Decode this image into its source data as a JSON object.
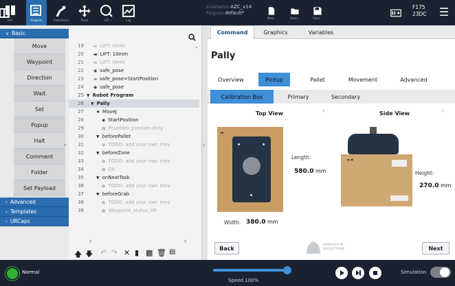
{
  "header": {
    "buttons": [
      {
        "label": "Run"
      },
      {
        "label": "Program"
      },
      {
        "label": "Installation"
      },
      {
        "label": "Move"
      },
      {
        "label": "I/O"
      },
      {
        "label": "Log"
      }
    ],
    "installation_label": "Installation",
    "installation_value": "AZC_v14",
    "program_label": "Program",
    "program_value": "default*",
    "new_label": "New...",
    "open_label": "Open...",
    "save_label": "Save...",
    "robot_name": "F175",
    "robot_sub": "23DC"
  },
  "nav": {
    "basic_label": "Basic",
    "items": [
      "Move",
      "Waypoint",
      "Direction",
      "Wait",
      "Set",
      "Popup",
      "Halt",
      "Comment",
      "Folder",
      "Set Payload"
    ],
    "advanced_label": "Advanced",
    "templates_label": "Templates",
    "urcaps_label": "URCaps"
  },
  "tree": {
    "rows": [
      {
        "n": "19",
        "t": "LIFT: 0mm"
      },
      {
        "n": "20",
        "t": "LIFT: 10mm"
      },
      {
        "n": "21",
        "t": "LIFT: 0mm"
      },
      {
        "n": "22",
        "t": "safe_pose"
      },
      {
        "n": "23",
        "t": "safe_pose=StartPosition"
      },
      {
        "n": "24",
        "t": "safe_pose"
      },
      {
        "n": "25",
        "t": "Robot Program"
      },
      {
        "n": "26",
        "t": "Pally"
      },
      {
        "n": "27",
        "t": "MoveJ"
      },
      {
        "n": "28",
        "t": "StartPosition"
      },
      {
        "n": "29",
        "t": "Pcustom_position.dirty"
      },
      {
        "n": "30",
        "t": "beforePallet"
      },
      {
        "n": "31",
        "t": "TODO: add your own mov"
      },
      {
        "n": "32",
        "t": "beforeZone"
      },
      {
        "n": "33",
        "t": "TODO: add your own mov"
      },
      {
        "n": "34",
        "t": "Ok"
      },
      {
        "n": "35",
        "t": "onNextTask"
      },
      {
        "n": "36",
        "t": "TODO: add your own mov"
      },
      {
        "n": "37",
        "t": "beforeGrab"
      },
      {
        "n": "38",
        "t": "TODO: add your own mov"
      },
      {
        "n": "39",
        "t": "Waypoint_status_lift"
      }
    ]
  },
  "right": {
    "top_tabs": [
      "Command",
      "Graphics",
      "Variables"
    ],
    "title": "Pally",
    "sub_tabs": [
      "Overview",
      "Pickup",
      "Pallet",
      "Movement",
      "Advanced"
    ],
    "calib_tabs": [
      "Calibration Box",
      "Primary",
      "Secondary"
    ],
    "top_view_label": "Top View",
    "side_view_label": "Side View",
    "length_label": "Length:",
    "length_value": "580.0",
    "width_label": "Width:",
    "width_value": "380.0",
    "height_label": "Height:",
    "height_value": "270.0",
    "unit": "mm",
    "back_label": "Back",
    "next_label": "Next",
    "brand_line1": "POWERED BY",
    "brand_line2": "ROCKETFARM"
  },
  "footer": {
    "status": "Normal",
    "speed_label": "Speed 100%",
    "speed_percent": 100,
    "simulation_label": "Simulation"
  }
}
